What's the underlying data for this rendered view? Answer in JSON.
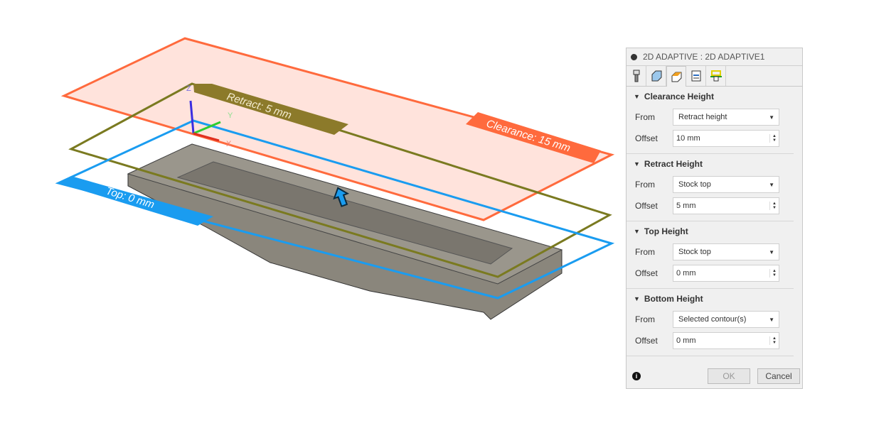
{
  "viewport": {
    "clearance_label": "Clearance: 15 mm",
    "retract_label": "Retract: 5 mm",
    "top_label": "Top: 0 mm",
    "axes": {
      "x": "X",
      "y": "Y",
      "z": "Z"
    },
    "colors": {
      "clearance": "#ff6a3d",
      "retract": "#8c7a2a",
      "top": "#1a9cf0",
      "part": "#8a867c"
    }
  },
  "panel": {
    "title": "2D ADAPTIVE : 2D ADAPTIVE1",
    "tabs": [
      "tool-icon",
      "geometry-icon",
      "heights-icon",
      "passes-icon",
      "linking-icon"
    ],
    "active_tab": 2,
    "sections": [
      {
        "title": "Clearance Height",
        "from_label": "From",
        "from": "Retract height",
        "offset_label": "Offset",
        "offset": "10 mm"
      },
      {
        "title": "Retract Height",
        "from_label": "From",
        "from": "Stock top",
        "offset_label": "Offset",
        "offset": "5 mm"
      },
      {
        "title": "Top Height",
        "from_label": "From",
        "from": "Stock top",
        "offset_label": "Offset",
        "offset": "0 mm"
      },
      {
        "title": "Bottom Height",
        "from_label": "From",
        "from": "Selected contour(s)",
        "offset_label": "Offset",
        "offset": "0 mm"
      }
    ],
    "ok": "OK",
    "cancel": "Cancel"
  }
}
